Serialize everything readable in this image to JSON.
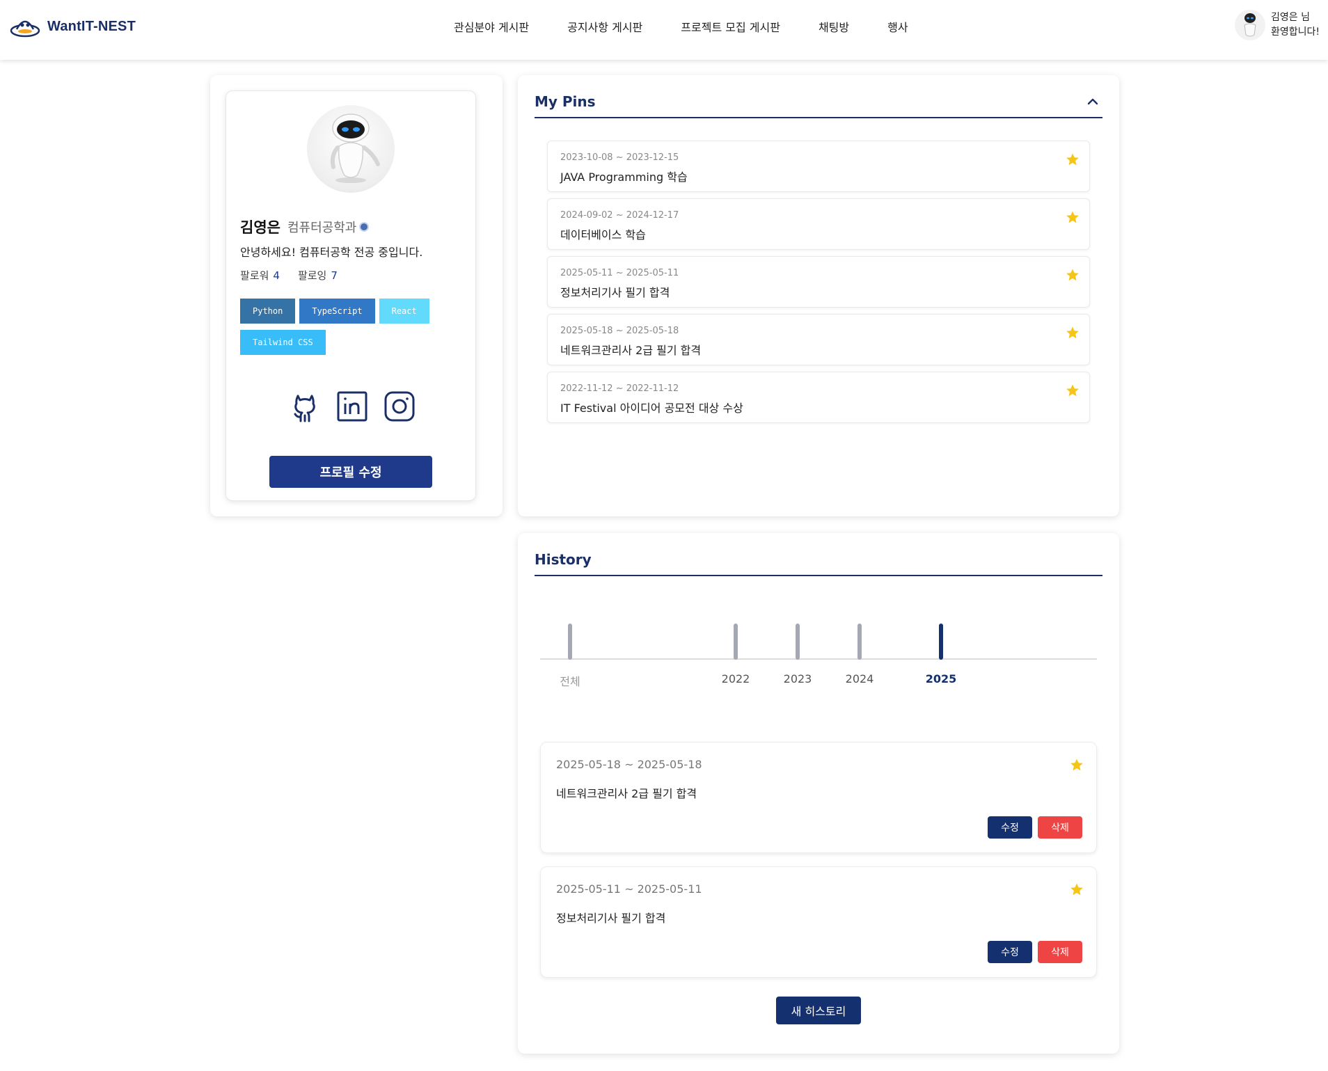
{
  "header": {
    "brand": "WantIT-NEST",
    "nav": [
      "관심분야 게시판",
      "공지사항 게시판",
      "프로젝트 모집 게시판",
      "채팅방",
      "행사"
    ],
    "user_greeting_line1": "김영은 님",
    "user_greeting_line2": "환영합니다!"
  },
  "profile": {
    "name": "김영은",
    "department": "컴퓨터공학과",
    "bio": "안녕하세요! 컴퓨터공학 전공 중입니다.",
    "followers_label": "팔로워",
    "followers": "4",
    "following_label": "팔로잉",
    "following": "7",
    "tags": [
      {
        "label": "Python",
        "color": "#3572a5"
      },
      {
        "label": "TypeScript",
        "color": "#3178c6"
      },
      {
        "label": "React",
        "color": "#61dafb"
      },
      {
        "label": "Tailwind CSS",
        "color": "#38bdf8"
      }
    ],
    "socials": [
      "github-icon",
      "linkedin-icon",
      "instagram-icon"
    ],
    "edit_button": "프로필 수정"
  },
  "pins": {
    "title": "My Pins",
    "items": [
      {
        "date": "2023-10-08 ~ 2023-12-15",
        "title": "JAVA Programming 학습"
      },
      {
        "date": "2024-09-02 ~ 2024-12-17",
        "title": "데이터베이스 학습"
      },
      {
        "date": "2025-05-11 ~ 2025-05-11",
        "title": "정보처리기사 필기 합격"
      },
      {
        "date": "2025-05-18 ~ 2025-05-18",
        "title": "네트워크관리사 2급 필기 합격"
      },
      {
        "date": "2022-11-12 ~ 2022-11-12",
        "title": "IT Festival 아이디어 공모전 대상 수상"
      }
    ]
  },
  "history": {
    "title": "History",
    "timeline": [
      {
        "label": "전체",
        "selected": false
      },
      {
        "label": "2022",
        "selected": false
      },
      {
        "label": "2023",
        "selected": false
      },
      {
        "label": "2024",
        "selected": false
      },
      {
        "label": "2025",
        "selected": true
      }
    ],
    "items": [
      {
        "date": "2025-05-18 ~ 2025-05-18",
        "title": "네트워크관리사 2급 필기 합격",
        "edit": "수정",
        "delete": "삭제"
      },
      {
        "date": "2025-05-11 ~ 2025-05-11",
        "title": "정보처리기사 필기 합격",
        "edit": "수정",
        "delete": "삭제"
      }
    ],
    "new_button": "새 히스토리"
  },
  "colors": {
    "brand_navy": "#1a2f66",
    "button_navy": "#14306e",
    "delete_red": "#ef4444",
    "star": "#f5c518",
    "tick": "#a3a8b3"
  }
}
